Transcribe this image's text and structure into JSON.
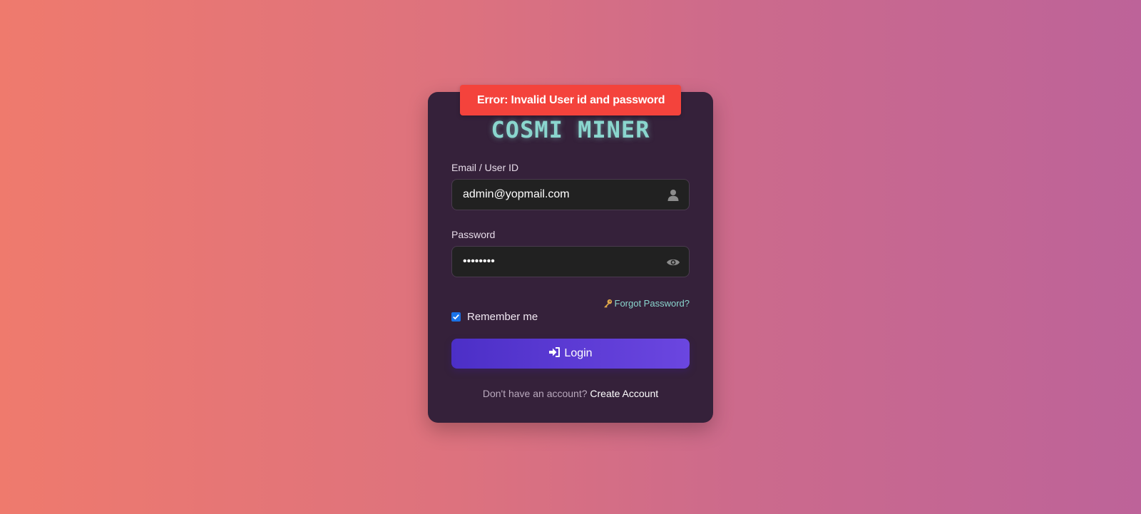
{
  "error_toast": {
    "text": "Error: Invalid User id and password",
    "color": "#f4433c"
  },
  "brand": {
    "title": "COSMI MINER",
    "color": "#8ad6ce"
  },
  "email_field": {
    "label": "Email / User ID",
    "value": "admin@yopmail.com",
    "icon": "user-icon"
  },
  "password_field": {
    "label": "Password",
    "value": "••••••••",
    "icon": "eye-icon"
  },
  "forgot_password": {
    "label": "Forgot Password?",
    "icon": "key-icon"
  },
  "remember_me": {
    "label": "Remember me",
    "checked": true
  },
  "login_button": {
    "label": "Login",
    "icon": "sign-in-icon",
    "color": "#5a3ad5"
  },
  "signup": {
    "prompt": "Don't have an account?",
    "link": "Create Account"
  }
}
